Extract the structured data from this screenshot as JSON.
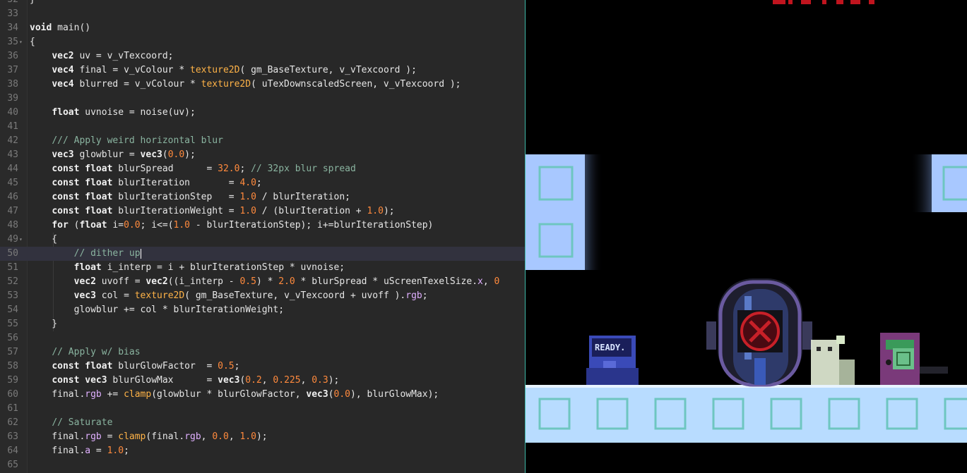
{
  "editor": {
    "active_line": "50",
    "lines": [
      {
        "n": "32",
        "fold": "",
        "parts": [
          [
            "",
            "}"
          ]
        ]
      },
      {
        "n": "33",
        "fold": "",
        "parts": []
      },
      {
        "n": "34",
        "fold": "",
        "parts": [
          [
            "kw",
            "void"
          ],
          [
            "",
            " main()"
          ]
        ]
      },
      {
        "n": "35",
        "fold": "▾",
        "parts": [
          [
            "",
            "{"
          ]
        ]
      },
      {
        "n": "36",
        "fold": "",
        "parts": [
          [
            "",
            "    "
          ],
          [
            "ty",
            "vec2"
          ],
          [
            "",
            " uv = v_vTexcoord;"
          ]
        ]
      },
      {
        "n": "37",
        "fold": "",
        "parts": [
          [
            "",
            "    "
          ],
          [
            "ty",
            "vec4"
          ],
          [
            "",
            " final = v_vColour * "
          ],
          [
            "fn",
            "texture2D"
          ],
          [
            "",
            "( gm_BaseTexture, v_vTexcoord );"
          ]
        ]
      },
      {
        "n": "38",
        "fold": "",
        "parts": [
          [
            "",
            "    "
          ],
          [
            "ty",
            "vec4"
          ],
          [
            "",
            " blurred = v_vColour * "
          ],
          [
            "fn",
            "texture2D"
          ],
          [
            "",
            "( uTexDownscaledScreen, v_vTexcoord );"
          ]
        ]
      },
      {
        "n": "39",
        "fold": "",
        "parts": []
      },
      {
        "n": "40",
        "fold": "",
        "parts": [
          [
            "",
            "    "
          ],
          [
            "ty",
            "float"
          ],
          [
            "",
            " uvnoise = noise(uv);"
          ]
        ]
      },
      {
        "n": "41",
        "fold": "",
        "parts": []
      },
      {
        "n": "42",
        "fold": "",
        "parts": [
          [
            "",
            "    "
          ],
          [
            "cm",
            "/// Apply weird horizontal blur"
          ]
        ]
      },
      {
        "n": "43",
        "fold": "",
        "parts": [
          [
            "",
            "    "
          ],
          [
            "ty",
            "vec3"
          ],
          [
            "",
            " glowblur = "
          ],
          [
            "ty",
            "vec3"
          ],
          [
            "",
            "("
          ],
          [
            "num",
            "0.0"
          ],
          [
            "",
            ");"
          ]
        ]
      },
      {
        "n": "44",
        "fold": "",
        "parts": [
          [
            "",
            "    "
          ],
          [
            "kw",
            "const"
          ],
          [
            "",
            " "
          ],
          [
            "ty",
            "float"
          ],
          [
            "",
            " blurSpread      = "
          ],
          [
            "num",
            "32.0"
          ],
          [
            "",
            "; "
          ],
          [
            "cm",
            "// 32px blur spread"
          ]
        ]
      },
      {
        "n": "45",
        "fold": "",
        "parts": [
          [
            "",
            "    "
          ],
          [
            "kw",
            "const"
          ],
          [
            "",
            " "
          ],
          [
            "ty",
            "float"
          ],
          [
            "",
            " blurIteration       = "
          ],
          [
            "num",
            "4.0"
          ],
          [
            "",
            ";"
          ]
        ]
      },
      {
        "n": "46",
        "fold": "",
        "parts": [
          [
            "",
            "    "
          ],
          [
            "kw",
            "const"
          ],
          [
            "",
            " "
          ],
          [
            "ty",
            "float"
          ],
          [
            "",
            " blurIterationStep   = "
          ],
          [
            "num",
            "1.0"
          ],
          [
            "",
            " / blurIteration;"
          ]
        ]
      },
      {
        "n": "47",
        "fold": "",
        "parts": [
          [
            "",
            "    "
          ],
          [
            "kw",
            "const"
          ],
          [
            "",
            " "
          ],
          [
            "ty",
            "float"
          ],
          [
            "",
            " blurIterationWeight = "
          ],
          [
            "num",
            "1.0"
          ],
          [
            "",
            " / (blurIteration + "
          ],
          [
            "num",
            "1.0"
          ],
          [
            "",
            ");"
          ]
        ]
      },
      {
        "n": "48",
        "fold": "",
        "parts": [
          [
            "",
            "    "
          ],
          [
            "kw",
            "for"
          ],
          [
            "",
            " ("
          ],
          [
            "ty",
            "float"
          ],
          [
            "",
            " i="
          ],
          [
            "num",
            "0.0"
          ],
          [
            "",
            "; i<=("
          ],
          [
            "num",
            "1.0"
          ],
          [
            "",
            " - blurIterationStep); i+=blurIterationStep)"
          ]
        ]
      },
      {
        "n": "49",
        "fold": "▾",
        "parts": [
          [
            "",
            "    {"
          ]
        ]
      },
      {
        "n": "50",
        "fold": "",
        "parts": [
          [
            "",
            "        "
          ],
          [
            "cm",
            "// dither up"
          ]
        ],
        "cursor": true
      },
      {
        "n": "51",
        "fold": "",
        "parts": [
          [
            "",
            "        "
          ],
          [
            "ty",
            "float"
          ],
          [
            "",
            " i_interp = i + blurIterationStep * uvnoise;"
          ]
        ]
      },
      {
        "n": "52",
        "fold": "",
        "parts": [
          [
            "",
            "        "
          ],
          [
            "ty",
            "vec2"
          ],
          [
            "",
            " uvoff = "
          ],
          [
            "ty",
            "vec2"
          ],
          [
            "",
            "((i_interp - "
          ],
          [
            "num",
            "0.5"
          ],
          [
            "",
            ") * "
          ],
          [
            "num",
            "2.0"
          ],
          [
            "",
            " * blurSpread * uScreenTexelSize."
          ],
          [
            "field",
            "x"
          ],
          [
            "",
            ", "
          ],
          [
            "num",
            "0"
          ]
        ]
      },
      {
        "n": "53",
        "fold": "",
        "parts": [
          [
            "",
            "        "
          ],
          [
            "ty",
            "vec3"
          ],
          [
            "",
            " col = "
          ],
          [
            "fn",
            "texture2D"
          ],
          [
            "",
            "( gm_BaseTexture, v_vTexcoord + uvoff )."
          ],
          [
            "field",
            "rgb"
          ],
          [
            "",
            ";"
          ]
        ]
      },
      {
        "n": "54",
        "fold": "",
        "parts": [
          [
            "",
            "        glowblur += col * blurIterationWeight;"
          ]
        ]
      },
      {
        "n": "55",
        "fold": "",
        "parts": [
          [
            "",
            "    }"
          ]
        ]
      },
      {
        "n": "56",
        "fold": "",
        "parts": []
      },
      {
        "n": "57",
        "fold": "",
        "parts": [
          [
            "",
            "    "
          ],
          [
            "cm",
            "// Apply w/ bias"
          ]
        ]
      },
      {
        "n": "58",
        "fold": "",
        "parts": [
          [
            "",
            "    "
          ],
          [
            "kw",
            "const"
          ],
          [
            "",
            " "
          ],
          [
            "ty",
            "float"
          ],
          [
            "",
            " blurGlowFactor  = "
          ],
          [
            "num",
            "0.5"
          ],
          [
            "",
            ";"
          ]
        ]
      },
      {
        "n": "59",
        "fold": "",
        "parts": [
          [
            "",
            "    "
          ],
          [
            "kw",
            "const"
          ],
          [
            "",
            " "
          ],
          [
            "ty",
            "vec3"
          ],
          [
            "",
            " blurGlowMax      = "
          ],
          [
            "ty",
            "vec3"
          ],
          [
            "",
            "("
          ],
          [
            "num",
            "0.2"
          ],
          [
            "",
            ", "
          ],
          [
            "num",
            "0.225"
          ],
          [
            "",
            ", "
          ],
          [
            "num",
            "0.3"
          ],
          [
            "",
            ");"
          ]
        ]
      },
      {
        "n": "60",
        "fold": "",
        "parts": [
          [
            "",
            "    final."
          ],
          [
            "field",
            "rgb"
          ],
          [
            "",
            " += "
          ],
          [
            "fn",
            "clamp"
          ],
          [
            "",
            "(glowblur * blurGlowFactor, "
          ],
          [
            "ty",
            "vec3"
          ],
          [
            "",
            "("
          ],
          [
            "num",
            "0.0"
          ],
          [
            "",
            "), blurGlowMax);"
          ]
        ]
      },
      {
        "n": "61",
        "fold": "",
        "parts": []
      },
      {
        "n": "62",
        "fold": "",
        "parts": [
          [
            "",
            "    "
          ],
          [
            "cm",
            "// Saturate"
          ]
        ]
      },
      {
        "n": "63",
        "fold": "",
        "parts": [
          [
            "",
            "    final."
          ],
          [
            "field",
            "rgb"
          ],
          [
            "",
            " = "
          ],
          [
            "fn",
            "clamp"
          ],
          [
            "",
            "(final."
          ],
          [
            "field",
            "rgb"
          ],
          [
            "",
            ", "
          ],
          [
            "num",
            "0.0"
          ],
          [
            "",
            ", "
          ],
          [
            "num",
            "1.0"
          ],
          [
            "",
            ");"
          ]
        ]
      },
      {
        "n": "64",
        "fold": "",
        "parts": [
          [
            "",
            "    final."
          ],
          [
            "field",
            "a"
          ],
          [
            "",
            " = "
          ],
          [
            "num",
            "1.0"
          ],
          [
            "",
            ";"
          ]
        ]
      },
      {
        "n": "65",
        "fold": "",
        "parts": []
      }
    ]
  },
  "game": {
    "ready_screen_text": "READY."
  },
  "colors": {
    "editor_bg": "#282828",
    "accent_divider": "#3fb8a8",
    "tile_light": "#b8dcff"
  }
}
